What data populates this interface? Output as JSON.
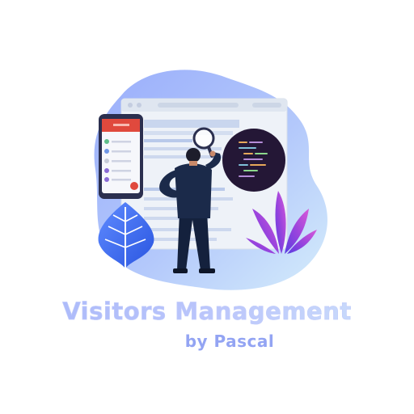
{
  "branding": {
    "title": "Visitors Management",
    "subtitle": "by Pascal"
  },
  "illustration": {
    "icons": [
      "browser-window-icon",
      "mobile-phone-icon",
      "magnifying-glass-icon",
      "code-screen-icon",
      "person-icon",
      "leaf-plant-icon",
      "purple-plant-icon"
    ]
  },
  "colors": {
    "blob_start": "#9fb4ff",
    "blob_end": "#cfe7fb",
    "title": "#b9c6fb",
    "subtitle": "#93a4f3",
    "suit": "#1b2a4a",
    "phone_header": "#e0493d",
    "code_screen": "#241736",
    "plant_purple": "#a34bdc",
    "leaf_blue": "#3e6ff0"
  }
}
